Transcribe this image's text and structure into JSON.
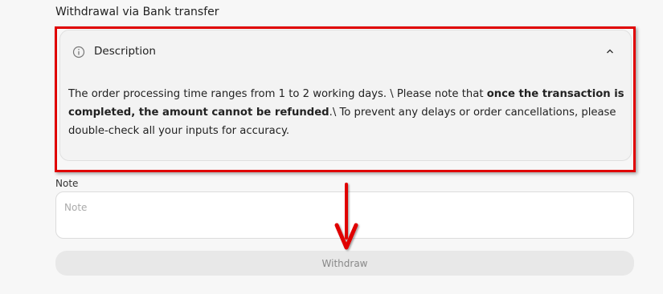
{
  "section_title": "Withdrawal via Bank transfer",
  "description": {
    "title": "Description",
    "text_1": "The order processing time ranges from 1 to 2 working days. \\ Please note that ",
    "text_bold": "once the transaction is completed, the amount cannot be refunded",
    "text_2": ".\\ To prevent any delays or order cancellations, please double-check all your inputs for accuracy."
  },
  "note": {
    "label": "Note",
    "placeholder": "Note",
    "value": ""
  },
  "withdraw_button": {
    "label": "Withdraw"
  },
  "colors": {
    "annotation": "#e00000",
    "button_bg": "#e8e8e8"
  },
  "icons": {
    "info": "info-icon",
    "chevron": "chevron-up-icon",
    "arrow": "red-down-arrow"
  }
}
